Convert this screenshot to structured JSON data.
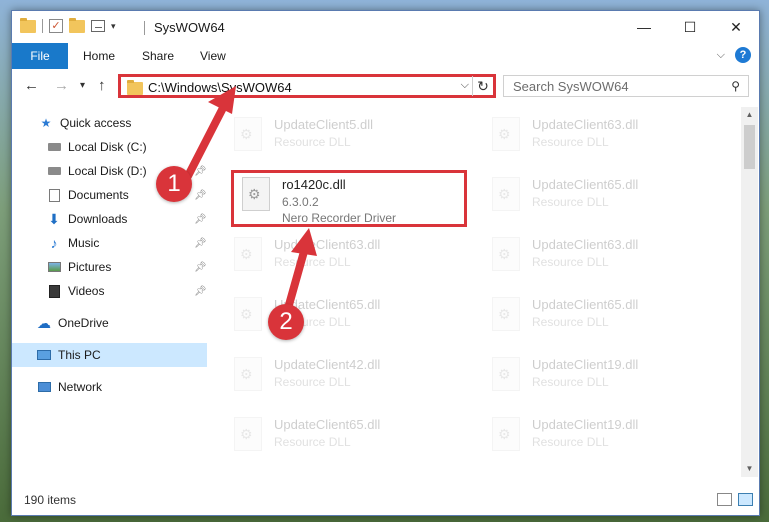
{
  "window": {
    "title": "SysWOW64",
    "controls": {
      "minimize": "—",
      "maximize": "☐",
      "close": "✕"
    }
  },
  "ribbon": {
    "tabs": [
      "File",
      "Home",
      "Share",
      "View"
    ],
    "expand_icon": "chevron-down-icon",
    "help": "?"
  },
  "address": {
    "path": "C:\\Windows\\SysWOW64",
    "back": "←",
    "forward": "→",
    "recent": "▾",
    "up": "↑",
    "dropdown": "⌵",
    "refresh": "↻"
  },
  "search": {
    "placeholder": "Search SysWOW64",
    "icon": "⚲"
  },
  "sidebar": {
    "items": [
      {
        "label": "Quick access",
        "icon": "star-icon"
      },
      {
        "label": "Local Disk (C:)",
        "icon": "drive-icon",
        "pinned": true
      },
      {
        "label": "Local Disk (D:)",
        "icon": "drive-icon",
        "pinned": true
      },
      {
        "label": "Documents",
        "icon": "documents-icon",
        "pinned": true
      },
      {
        "label": "Downloads",
        "icon": "downloads-icon",
        "pinned": true
      },
      {
        "label": "Music",
        "icon": "music-icon",
        "pinned": true
      },
      {
        "label": "Pictures",
        "icon": "pictures-icon",
        "pinned": true
      },
      {
        "label": "Videos",
        "icon": "videos-icon",
        "pinned": true
      },
      {
        "label": "OneDrive",
        "icon": "onedrive-icon"
      },
      {
        "label": "This PC",
        "icon": "computer-icon",
        "selected": true
      },
      {
        "label": "Network",
        "icon": "network-icon"
      }
    ]
  },
  "files": {
    "left": [
      {
        "name": "UpdateClient5.dll",
        "type": "Resource DLL"
      },
      {
        "name": "UpdateClient63.dll",
        "type": "Resource DLL"
      },
      {
        "name": "UpdateClient65.dll",
        "type": "Resource DLL"
      },
      {
        "name": "UpdateClient42.dll",
        "type": "Resource DLL"
      },
      {
        "name": "UpdateClient65.dll",
        "type": "Resource DLL"
      }
    ],
    "right": [
      {
        "name": "UpdateClient63.dll",
        "type": "Resource DLL"
      },
      {
        "name": "UpdateClient65.dll",
        "type": "Resource DLL"
      },
      {
        "name": "UpdateClient63.dll",
        "type": "Resource DLL"
      },
      {
        "name": "UpdateClient65.dll",
        "type": "Resource DLL"
      },
      {
        "name": "UpdateClient19.dll",
        "type": "Resource DLL"
      },
      {
        "name": "UpdateClient19.dll",
        "type": "Resource DLL"
      }
    ],
    "highlighted": {
      "name": "ro1420c.dll",
      "version": "6.3.0.2",
      "description": "Nero Recorder Driver"
    }
  },
  "status": {
    "item_count": "190 items"
  },
  "annotations": {
    "marker1": "1",
    "marker2": "2",
    "color": "#d9343a"
  }
}
